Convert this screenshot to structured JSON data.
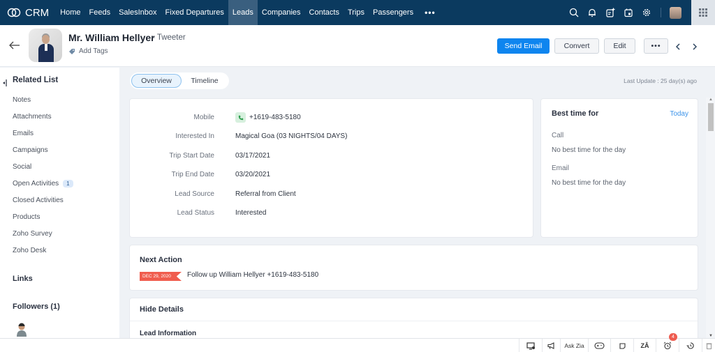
{
  "app": {
    "logo_text": "CRM"
  },
  "nav": {
    "items": [
      {
        "label": "Home",
        "active": false
      },
      {
        "label": "Feeds",
        "active": false
      },
      {
        "label": "SalesInbox",
        "active": false
      },
      {
        "label": "Fixed Departures",
        "active": false
      },
      {
        "label": "Leads",
        "active": true
      },
      {
        "label": "Companies",
        "active": false
      },
      {
        "label": "Contacts",
        "active": false
      },
      {
        "label": "Trips",
        "active": false
      },
      {
        "label": "Passengers",
        "active": false
      }
    ],
    "more_label": "•••",
    "right_icons": [
      "search-icon",
      "bell-icon",
      "add-note-icon",
      "calendar-icon",
      "gear-icon",
      "user-avatar",
      "apps-grid-icon"
    ]
  },
  "header": {
    "name": "Mr. William Hellyer",
    "subtitle": "- Tweeter",
    "add_tags": "Add Tags",
    "buttons": {
      "send_email": "Send Email",
      "convert": "Convert",
      "edit": "Edit",
      "more": "•••"
    }
  },
  "sidebar": {
    "related_list_title": "Related List",
    "items": [
      {
        "label": "Notes"
      },
      {
        "label": "Attachments"
      },
      {
        "label": "Emails"
      },
      {
        "label": "Campaigns"
      },
      {
        "label": "Social"
      },
      {
        "label": "Open Activities",
        "badge": "1"
      },
      {
        "label": "Closed Activities"
      },
      {
        "label": "Products"
      },
      {
        "label": "Zoho Survey"
      },
      {
        "label": "Zoho Desk"
      }
    ],
    "links_title": "Links",
    "followers_title": "Followers (1)"
  },
  "main": {
    "tabs": [
      {
        "label": "Overview",
        "active": true
      },
      {
        "label": "Timeline",
        "active": false
      }
    ],
    "last_update": "Last Update : 25 day(s) ago",
    "fields": [
      {
        "label": "Mobile",
        "value": "+1619-483-5180"
      },
      {
        "label": "Interested In",
        "value": "Magical Goa (03 NIGHTS/04 DAYS)"
      },
      {
        "label": "Trip Start Date",
        "value": "03/17/2021"
      },
      {
        "label": "Trip End Date",
        "value": "03/20/2021"
      },
      {
        "label": "Lead Source",
        "value": "Referral from Client"
      },
      {
        "label": "Lead Status",
        "value": "Interested"
      }
    ],
    "best_time": {
      "title": "Best time for",
      "today": "Today",
      "call_label": "Call",
      "call_value": "No best time for the day",
      "email_label": "Email",
      "email_value": "No best time for the day"
    },
    "next_action": {
      "title": "Next Action",
      "date": "DEC 29, 2020",
      "text": "Follow up William Hellyer +1619-483-5180"
    },
    "details": {
      "hide_label": "Hide Details",
      "section": "Lead Information"
    }
  },
  "bottombar": {
    "ask_zia": "Ask Zia",
    "reminder_badge": "4"
  },
  "colors": {
    "nav_bg": "#0b3a5f",
    "nav_active": "#3a5f7f",
    "primary": "#0e85ef",
    "date_tag": "#f05d4e",
    "link": "#3d94ea"
  }
}
